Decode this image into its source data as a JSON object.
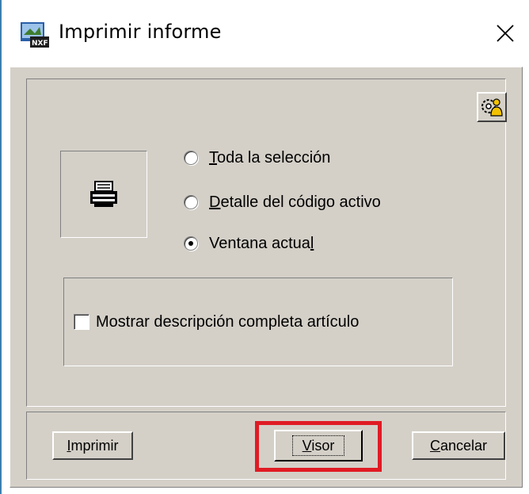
{
  "window": {
    "title": "Imprimir informe",
    "close_icon": "close-icon",
    "app_icon": "nxf-app-icon",
    "accent_color": "#3c7fb1"
  },
  "options": {
    "radios": [
      {
        "prefix": "",
        "underlined": "T",
        "rest": "oda la selección",
        "checked": false
      },
      {
        "prefix": "",
        "underlined": "D",
        "rest": "etalle del código activo",
        "checked": false
      },
      {
        "prefix": "Ventana actua",
        "underlined": "l",
        "rest": "",
        "checked": true
      }
    ],
    "printer_icon": "printer-icon",
    "config_icon": "settings-user-icon"
  },
  "checkbox": {
    "label": "Mostrar descripción completa artículo",
    "checked": false
  },
  "buttons": {
    "print": {
      "underlined": "I",
      "rest": "mprimir"
    },
    "visor": {
      "underlined": "V",
      "rest": "isor"
    },
    "cancel": {
      "underlined": "C",
      "rest": "ancelar"
    }
  },
  "highlight_color": "#e01b24"
}
